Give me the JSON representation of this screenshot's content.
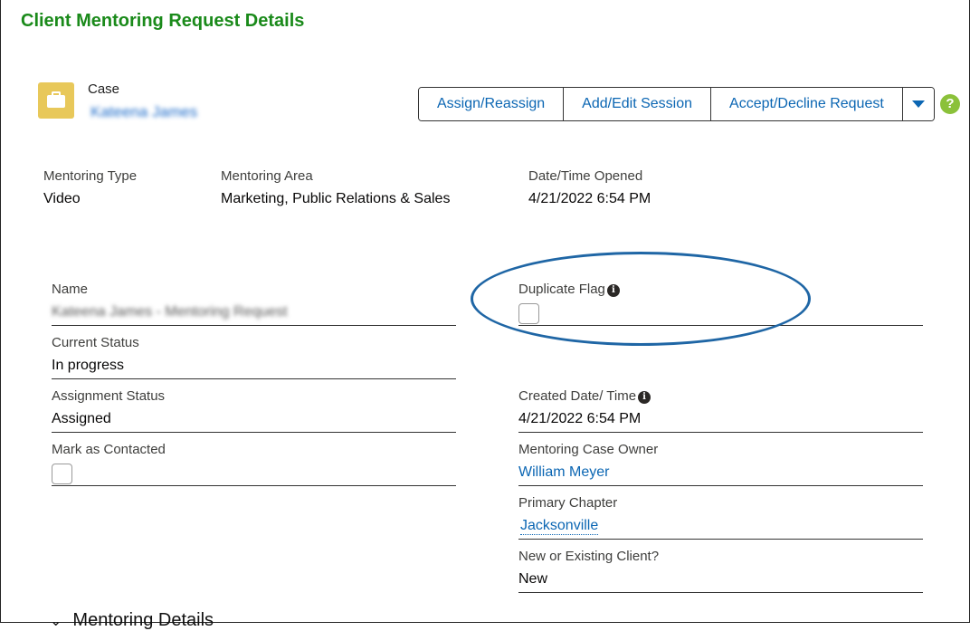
{
  "page_title": "Client Mentoring Request Details",
  "record": {
    "type_label": "Case",
    "name": "Kateena James"
  },
  "actions": {
    "assign": "Assign/Reassign",
    "session": "Add/Edit Session",
    "accept": "Accept/Decline Request",
    "help": "?"
  },
  "highlights": [
    {
      "label": "Mentoring Type",
      "value": "Video"
    },
    {
      "label": "Mentoring Area",
      "value": "Marketing, Public Relations & Sales"
    },
    {
      "label": "Date/Time Opened",
      "value": "4/21/2022 6:54 PM"
    }
  ],
  "fields": {
    "name": {
      "label": "Name",
      "value": "Kateena James - Mentoring Request"
    },
    "current_status": {
      "label": "Current Status",
      "value": "In progress"
    },
    "assignment_status": {
      "label": "Assignment Status",
      "value": "Assigned"
    },
    "mark_contacted": {
      "label": "Mark as Contacted",
      "checked": false
    },
    "duplicate_flag": {
      "label": "Duplicate Flag",
      "checked": false
    },
    "created": {
      "label": "Created Date/ Time",
      "value": "4/21/2022 6:54 PM"
    },
    "owner": {
      "label": "Mentoring Case Owner",
      "value": "William Meyer"
    },
    "chapter": {
      "label": "Primary Chapter",
      "value": "Jacksonville"
    },
    "client_type": {
      "label": "New or Existing Client?",
      "value": "New"
    }
  },
  "section": {
    "title": "Mentoring Details"
  },
  "info_glyph": "i"
}
